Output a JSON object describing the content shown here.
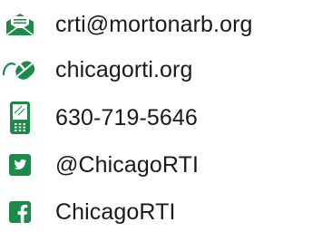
{
  "brand_color": "#1c8a4a",
  "contacts": [
    {
      "type": "email",
      "icon": "envelope-icon",
      "label": "crti@mortonarb.org"
    },
    {
      "type": "website",
      "icon": "mouse-icon",
      "label": "chicagorti.org"
    },
    {
      "type": "phone",
      "icon": "mobile-phone-icon",
      "label": "630-719-5646"
    },
    {
      "type": "twitter",
      "icon": "twitter-icon",
      "label": "@ChicagoRTI"
    },
    {
      "type": "facebook",
      "icon": "facebook-icon",
      "label": "ChicagoRTI"
    }
  ]
}
